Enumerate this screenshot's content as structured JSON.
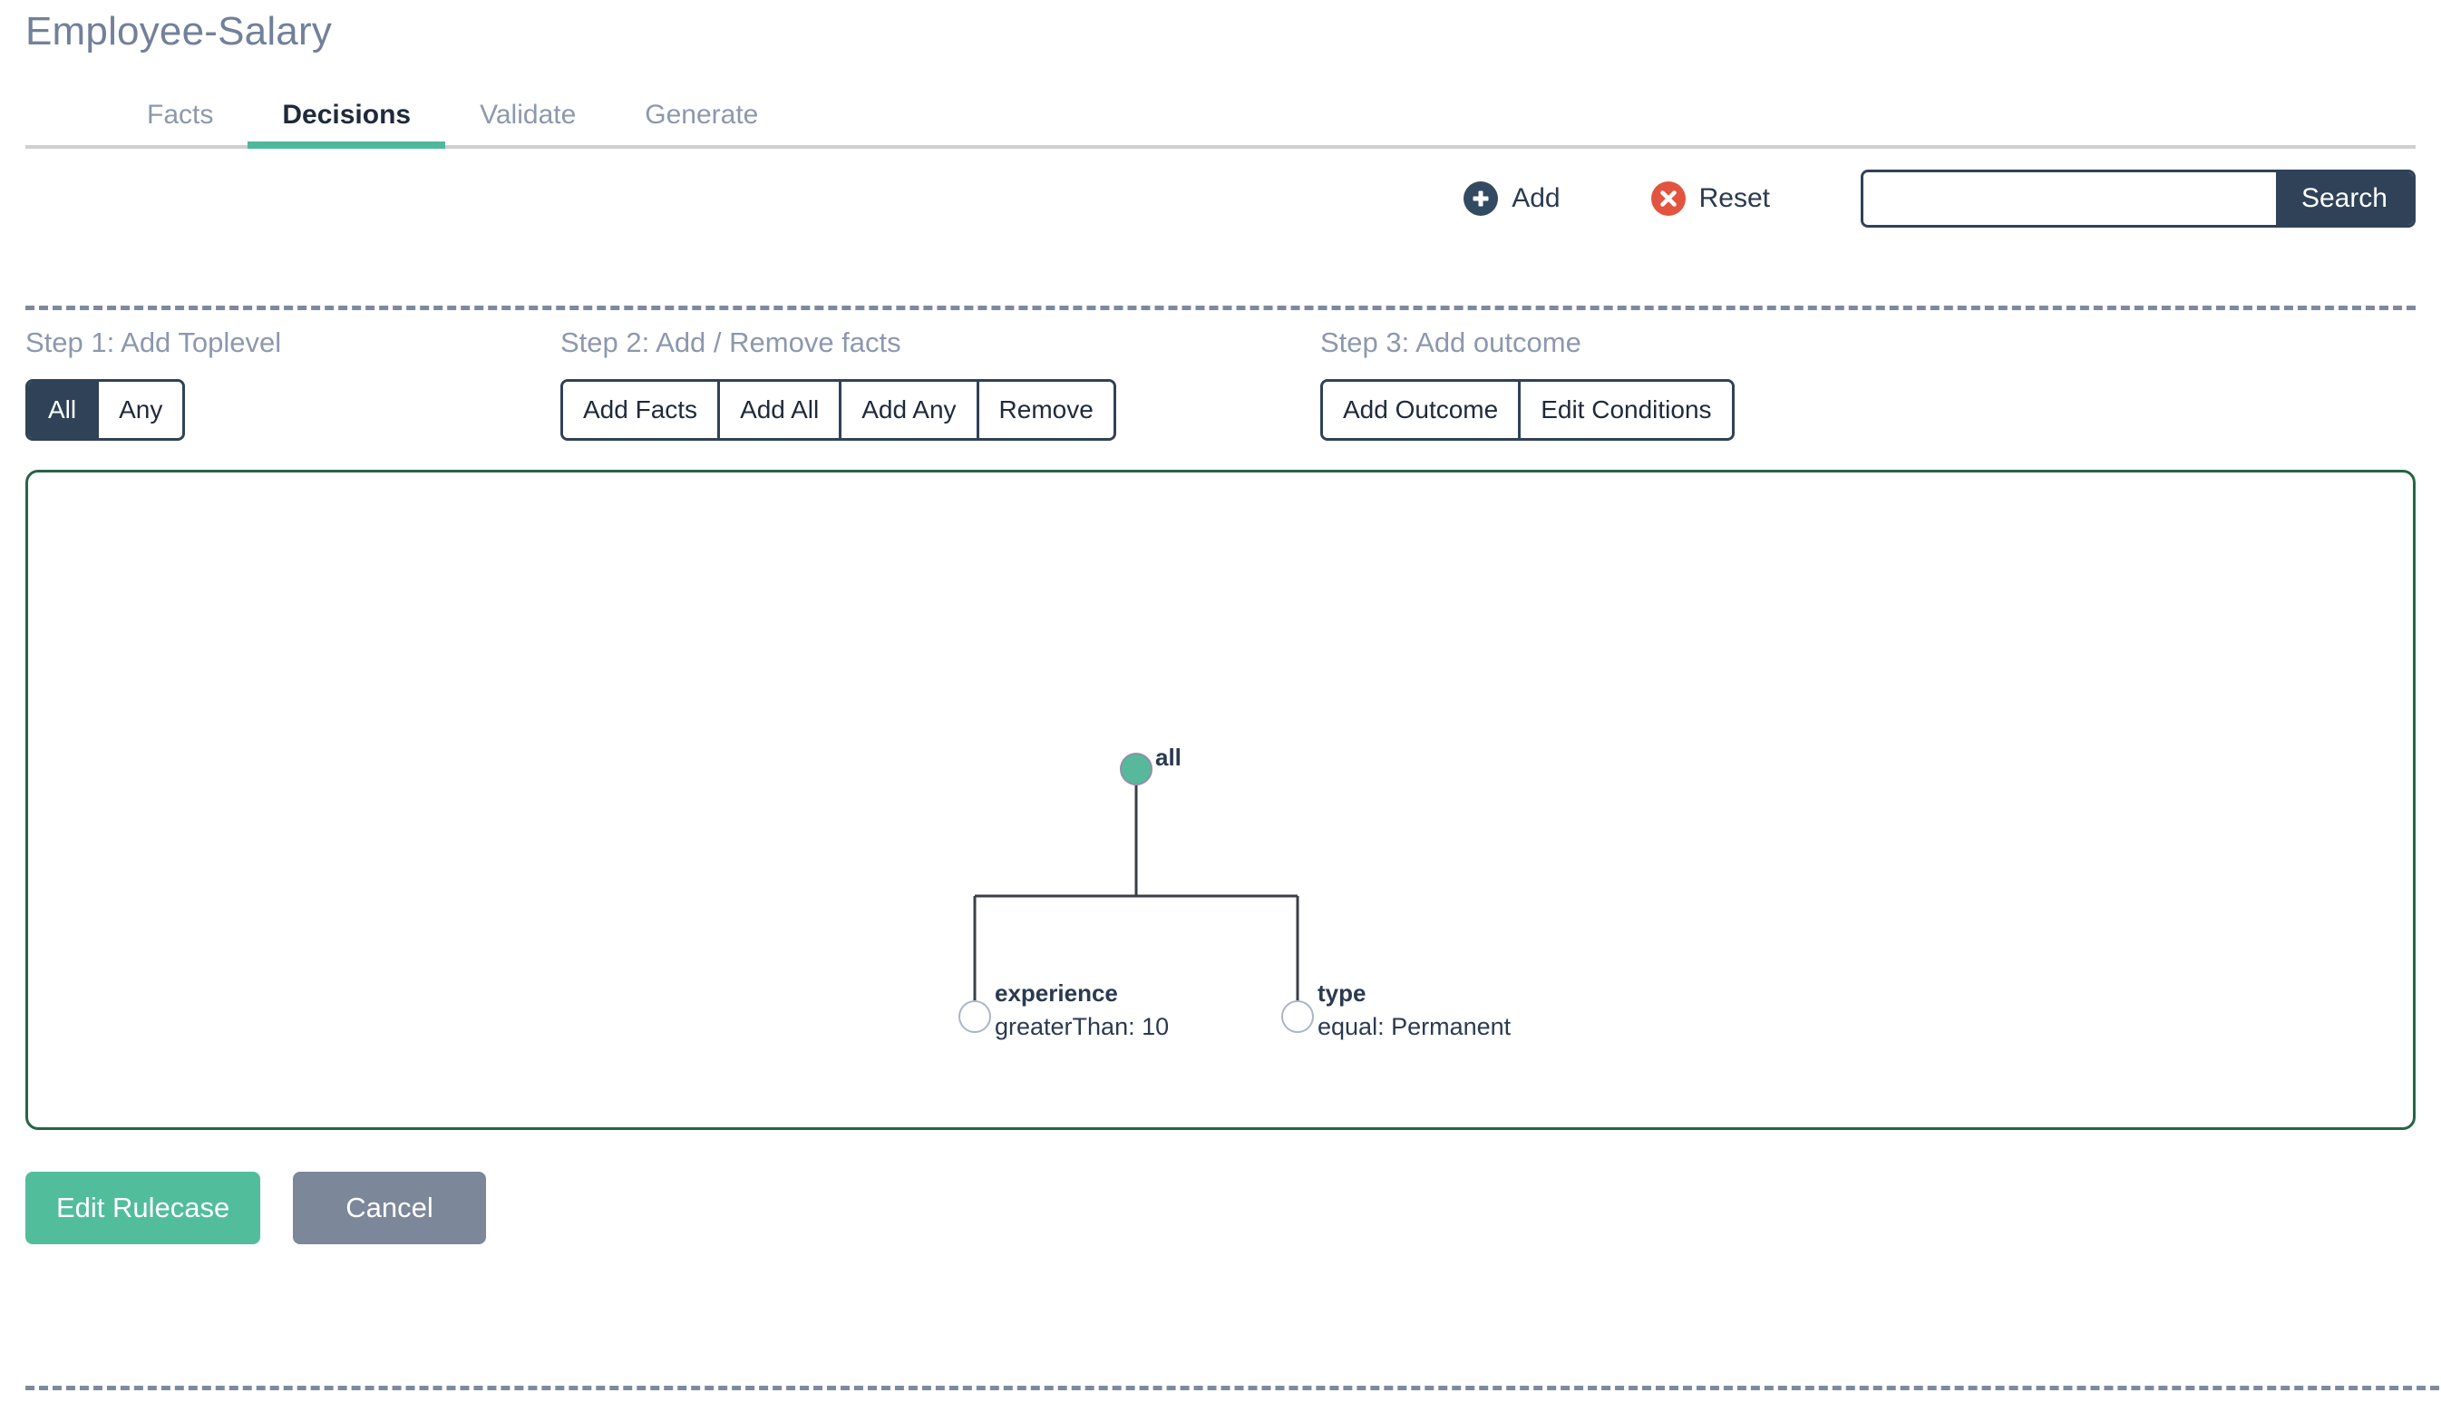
{
  "header": {
    "title": "Employee-Salary"
  },
  "tabs": [
    {
      "label": "Facts",
      "active": false
    },
    {
      "label": "Decisions",
      "active": true
    },
    {
      "label": "Validate",
      "active": false
    },
    {
      "label": "Generate",
      "active": false
    }
  ],
  "toolbar": {
    "add_label": "Add",
    "add_icon": "plus-circle-icon",
    "reset_label": "Reset",
    "reset_icon": "x-circle-icon",
    "search_value": "",
    "search_placeholder": "",
    "search_button_label": "Search"
  },
  "steps": [
    {
      "label": "Step 1: Add Toplevel",
      "buttons": [
        {
          "label": "All",
          "selected": true
        },
        {
          "label": "Any",
          "selected": false
        }
      ]
    },
    {
      "label": "Step 2: Add / Remove facts",
      "buttons": [
        {
          "label": "Add Facts",
          "selected": false
        },
        {
          "label": "Add All",
          "selected": false
        },
        {
          "label": "Add Any",
          "selected": false
        },
        {
          "label": "Remove",
          "selected": false
        }
      ]
    },
    {
      "label": "Step 3: Add outcome",
      "buttons": [
        {
          "label": "Add Outcome",
          "selected": false
        },
        {
          "label": "Edit Conditions",
          "selected": false
        }
      ]
    }
  ],
  "tree": {
    "root": {
      "label": "all",
      "fill": "#56b99b",
      "stroke": "#8d8fa8"
    },
    "children": [
      {
        "label": "experience",
        "condition": "greaterThan: 10",
        "fill": "#ffffff",
        "stroke": "#aab6c6"
      },
      {
        "label": "type",
        "condition": "equal: Permanent",
        "fill": "#ffffff",
        "stroke": "#aab6c6"
      }
    ],
    "link_color": "#3b3f46",
    "border_color": "#256548"
  },
  "footer": {
    "primary_label": "Edit Rulecase",
    "primary_color": "#52bd9b",
    "secondary_label": "Cancel",
    "secondary_color": "#7c8799"
  }
}
